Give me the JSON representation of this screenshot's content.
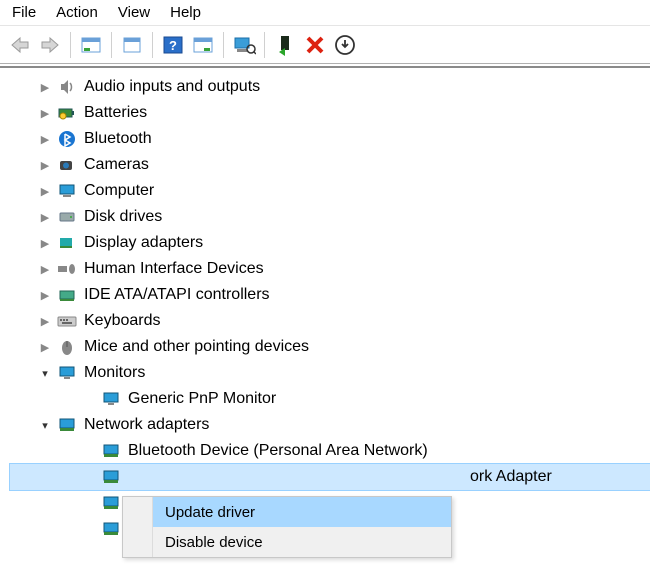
{
  "menubar": {
    "file": "File",
    "action": "Action",
    "view": "View",
    "help": "Help"
  },
  "tree": {
    "audio": "Audio inputs and outputs",
    "batteries": "Batteries",
    "bluetooth": "Bluetooth",
    "cameras": "Cameras",
    "computer": "Computer",
    "disk": "Disk drives",
    "display": "Display adapters",
    "hid": "Human Interface Devices",
    "ide": "IDE ATA/ATAPI controllers",
    "keyboards": "Keyboards",
    "mice": "Mice and other pointing devices",
    "monitors": "Monitors",
    "generic_monitor": "Generic PnP Monitor",
    "network": "Network adapters",
    "bt_device": "Bluetooth Device (Personal Area Network)",
    "wifi_adapter_tail": "ork Adapter"
  },
  "context_menu": {
    "update": "Update driver",
    "disable": "Disable device"
  }
}
